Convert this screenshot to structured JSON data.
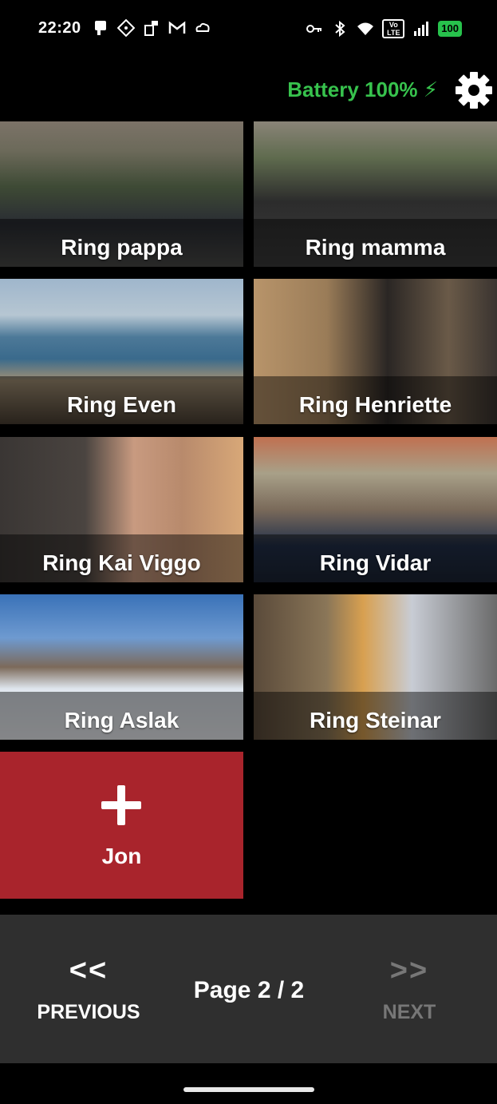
{
  "status_bar": {
    "time": "22:20",
    "left_icons": [
      "device-icon",
      "dice-icon",
      "sim-icon",
      "gmail-icon",
      "cloud-icon"
    ],
    "right_icons": [
      "key-icon",
      "bluetooth-icon",
      "wifi-icon",
      "volte-icon",
      "signal-icon"
    ],
    "volte_label": "Vo LTE",
    "battery_level": "100"
  },
  "header": {
    "battery_text": "Battery 100% ⚡",
    "battery_color": "#37c24d"
  },
  "contacts": [
    {
      "label": "Ring pappa"
    },
    {
      "label": "Ring mamma"
    },
    {
      "label": "Ring Even"
    },
    {
      "label": "Ring Henriette"
    },
    {
      "label": "Ring Kai Viggo"
    },
    {
      "label": "Ring Vidar"
    },
    {
      "label": "Ring Aslak"
    },
    {
      "label": "Ring Steinar"
    }
  ],
  "add_tile": {
    "label": "Jon",
    "color": "#a9242c"
  },
  "nav": {
    "previous_arrows": "<<",
    "previous_label": "PREVIOUS",
    "page_indicator": "Page 2 / 2",
    "next_arrows": ">>",
    "next_label": "NEXT"
  }
}
